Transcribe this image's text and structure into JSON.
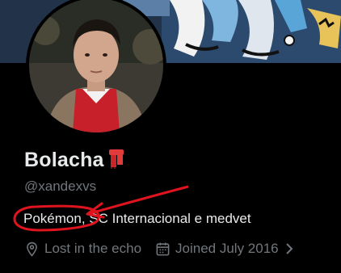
{
  "profile": {
    "display_name": "Bolacha",
    "handle": "@xandexvs",
    "bio": "Pokémon, SC Internacional e medvet",
    "location": "Lost in the echo",
    "joined": "Joined July 2016"
  },
  "icons": {
    "location": "location-pin-icon",
    "calendar": "calendar-icon",
    "chevron": "chevron-right-icon",
    "name_emoji": "scarf-icon"
  },
  "colors": {
    "background": "#000000",
    "primary_text": "#e7e9ea",
    "secondary_text": "#71767b",
    "annotation": "#e0141e"
  }
}
